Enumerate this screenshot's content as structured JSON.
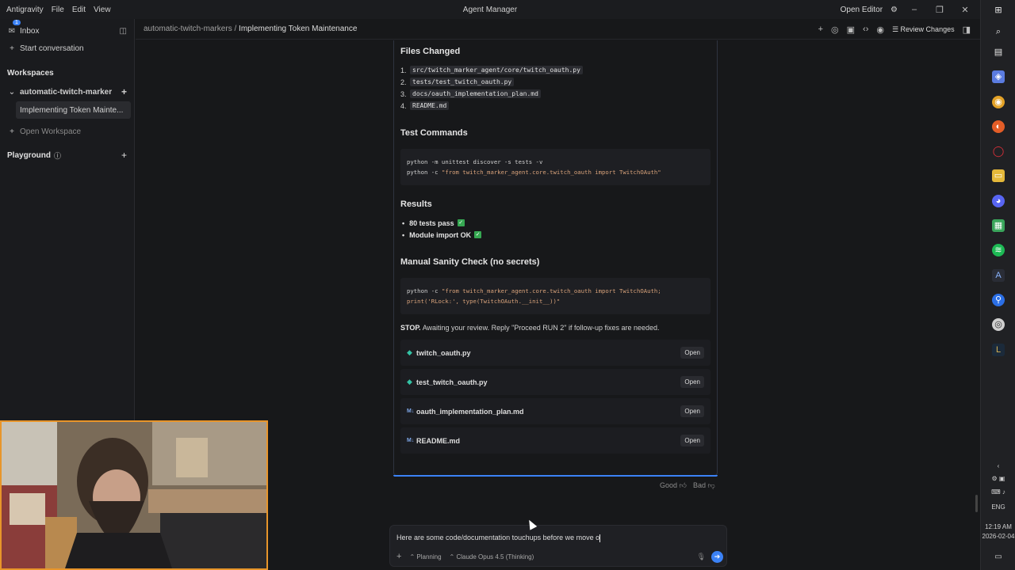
{
  "titlebar": {
    "menu": [
      "Antigravity",
      "File",
      "Edit",
      "View"
    ],
    "title": "Agent Manager",
    "open_editor": "Open Editor"
  },
  "sidebar": {
    "inbox": "Inbox",
    "inbox_badge": "1",
    "start_conversation": "Start conversation",
    "workspaces_label": "Workspaces",
    "workspace_name": "automatic-twitch-marker",
    "conversation": "Implementing Token Mainte...",
    "open_workspace": "Open Workspace",
    "playground": "Playground"
  },
  "header": {
    "breadcrumb_workspace": "automatic-twitch-markers",
    "breadcrumb_separator": "/",
    "breadcrumb_title": "Implementing Token Maintenance",
    "review_changes": "Review Changes"
  },
  "content": {
    "files_changed_heading": "Files Changed",
    "files_changed": [
      "src/twitch_marker_agent/core/twitch_oauth.py",
      "tests/test_twitch_oauth.py",
      "docs/oauth_implementation_plan.md",
      "README.md"
    ],
    "test_commands_heading": "Test Commands",
    "test_cmd_1": "python -m unittest discover -s tests -v",
    "test_cmd_2_prefix": "python -c ",
    "test_cmd_2_string": "\"from twitch_marker_agent.core.twitch_oauth import TwitchOAuth\"",
    "results_heading": "Results",
    "results": [
      "80 tests pass",
      "Module import OK"
    ],
    "sanity_heading": "Manual Sanity Check (no secrets)",
    "sanity_prefix": "python -c ",
    "sanity_line1": "\"from twitch_marker_agent.core.twitch_oauth import TwitchOAuth;",
    "sanity_line2": "print('RLock:', type(TwitchOAuth.__init__))\"",
    "stop_bold": "STOP.",
    "stop_text": " Awaiting your review. Reply \"Proceed RUN 2\" if follow-up fixes are needed.",
    "file_links": [
      {
        "name": "twitch_oauth.py",
        "kind": "py"
      },
      {
        "name": "test_twitch_oauth.py",
        "kind": "py"
      },
      {
        "name": "oauth_implementation_plan.md",
        "kind": "md"
      },
      {
        "name": "README.md",
        "kind": "md"
      }
    ],
    "open_label": "Open",
    "feedback_good": "Good",
    "feedback_bad": "Bad"
  },
  "composer": {
    "text": "Here are some code/documentation touchups before we move o",
    "mode": "Planning",
    "model": "Claude Opus 4.5 (Thinking)"
  },
  "taskbar": {
    "lang": "ENG",
    "time": "12:19 AM",
    "date": "2026-02-04"
  },
  "colors": {
    "accent": "#3b82f6",
    "webcam_border": "#e8952a",
    "success": "#36a852"
  }
}
